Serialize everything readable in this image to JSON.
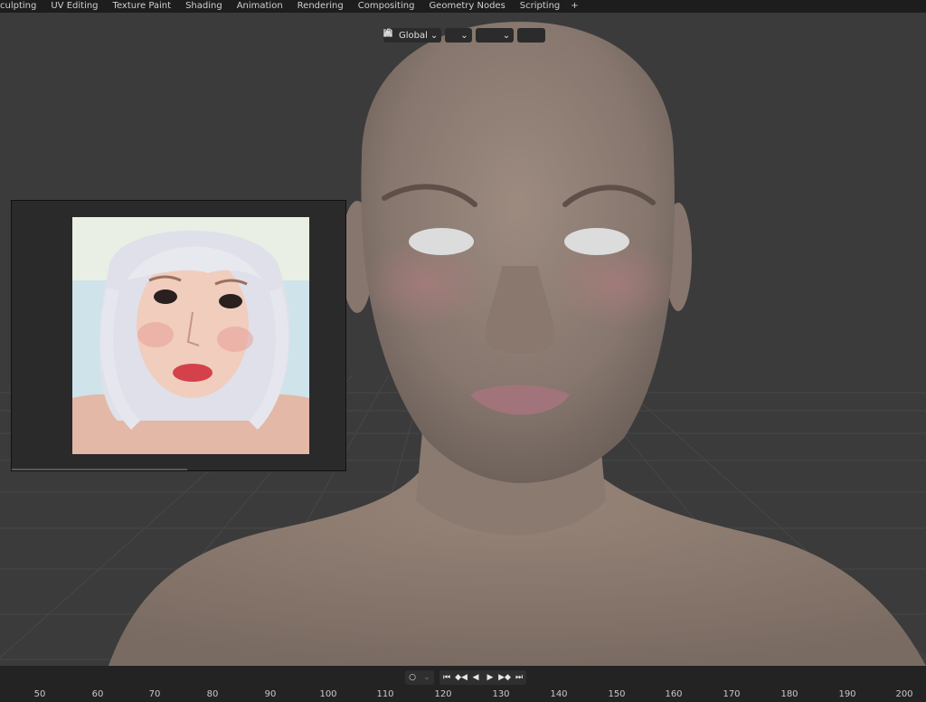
{
  "workspace_tabs": [
    "culpting",
    "UV Editing",
    "Texture Paint",
    "Shading",
    "Animation",
    "Rendering",
    "Compositing",
    "Geometry Nodes",
    "Scripting"
  ],
  "add_tab_label": "+",
  "viewport_header": {
    "transform_orientation": "Global",
    "pivot_icon": "link-icon",
    "snap_icon": "magnet-icon",
    "snap_target_icon": "snap-increment-icon",
    "proportional_icon": "proportional-edit-icon",
    "falloff_icon": "falloff-curve-icon"
  },
  "reference_image": {
    "description_icon": "reference-photo"
  },
  "timeline": {
    "frame_ticks": [
      "50",
      "60",
      "70",
      "80",
      "90",
      "100",
      "110",
      "120",
      "130",
      "140",
      "150",
      "160",
      "170",
      "180",
      "190",
      "200"
    ]
  },
  "colors": {
    "viewport_bg": "#3b3b3b",
    "grid_line": "#4a4a4a",
    "skin": "#8a7a70",
    "topbar_bg": "#1d1d1d"
  }
}
